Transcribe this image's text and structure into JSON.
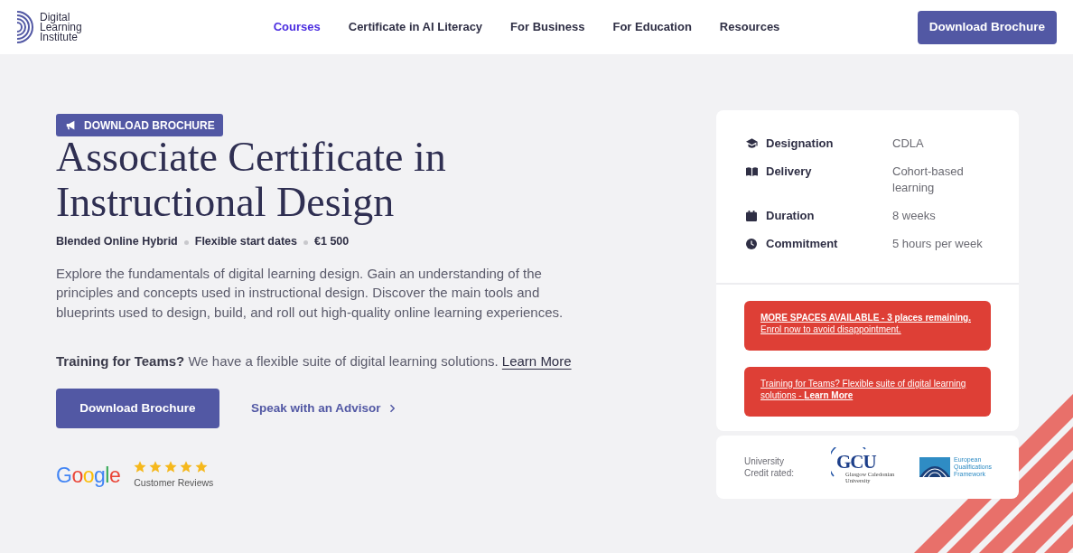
{
  "header": {
    "logo": {
      "lines": [
        "Digital",
        "Learning",
        "Institute"
      ]
    },
    "nav": [
      {
        "label": "Courses",
        "selected": true
      },
      {
        "label": "Certificate in AI Literacy",
        "selected": false
      },
      {
        "label": "For Business",
        "selected": false
      },
      {
        "label": "For Education",
        "selected": false
      },
      {
        "label": "Resources",
        "selected": false
      }
    ],
    "cta_button": "Download Brochure"
  },
  "hero": {
    "badge": "DOWNLOAD BROCHURE",
    "title": "Associate Certificate in Instructional Design",
    "meta": [
      "Blended Online Hybrid",
      "Flexible start dates",
      "€1 500"
    ],
    "description": "Explore the fundamentals of digital learning design. Gain an understanding of the principles and concepts used in instructional design. Discover the main tools and blueprints used to design, build, and roll out high-quality online learning experiences.",
    "teams_note": {
      "text": "**Training for Teams?** We have a flexible suite of digital learning solutions.",
      "link": "Learn More"
    },
    "primary_button": "Download Brochure",
    "advisor_link": "Speak with an Advisor",
    "reviews": {
      "logo": "Google",
      "stars": 5,
      "label": "Customer Reviews"
    }
  },
  "details_card": {
    "rows": [
      {
        "label": "Designation",
        "value": "CDLA"
      },
      {
        "label": "Delivery",
        "value": "Cohort-based learning"
      },
      {
        "label": "Duration",
        "value": "8 weeks"
      },
      {
        "label": "Commitment",
        "value": "5 hours per week"
      }
    ],
    "notices": [
      "**MORE SPACES AVAILABLE - 3 places remaining.** Enrol now to avoid disappointment.",
      "Training for Teams? Flexible suite of digital learning solutions - **Learn More**"
    ]
  },
  "accreditation": {
    "label": "University Credit rated:",
    "logos": [
      {
        "kind": "university",
        "name": "GCU",
        "subtitle": "Glasgow Caledonian University"
      },
      {
        "kind": "framework",
        "lines": [
          "European",
          "Qualifications",
          "Framework"
        ]
      }
    ]
  }
}
